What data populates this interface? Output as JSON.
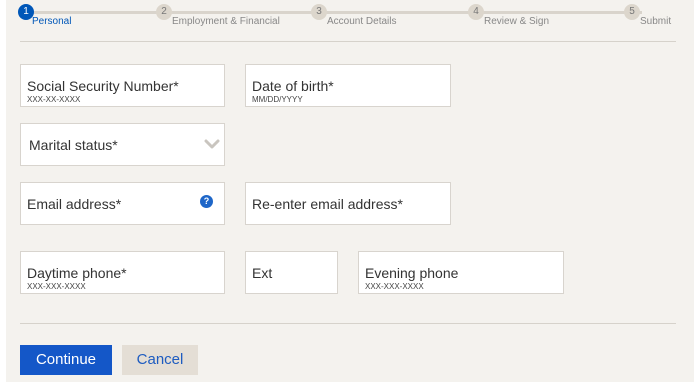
{
  "stepper": {
    "steps": [
      {
        "number": "1",
        "label": "Personal"
      },
      {
        "number": "2",
        "label": "Employment & Financial"
      },
      {
        "number": "3",
        "label": "Account Details"
      },
      {
        "number": "4",
        "label": "Review & Sign"
      },
      {
        "number": "5",
        "label": "Submit"
      }
    ],
    "active_step": 1
  },
  "form": {
    "ssn": {
      "label": "Social Security Number*",
      "hint": "XXX-XX-XXXX"
    },
    "dob": {
      "label": "Date of birth*",
      "hint": "MM/DD/YYYY"
    },
    "marital": {
      "label": "Marital status*"
    },
    "email": {
      "label": "Email address*",
      "help": "?"
    },
    "email_confirm": {
      "label": "Re-enter email address*"
    },
    "daytime_phone": {
      "label": "Daytime phone*",
      "hint": "XXX-XXX-XXXX"
    },
    "ext": {
      "label": "Ext"
    },
    "evening_phone": {
      "label": "Evening phone",
      "hint": "XXX-XXX-XXXX"
    }
  },
  "actions": {
    "continue_label": "Continue",
    "cancel_label": "Cancel"
  },
  "colors": {
    "accent": "#1457c8",
    "panel_bg": "#f4f2ee",
    "step_inactive": "#dcd6cc"
  }
}
